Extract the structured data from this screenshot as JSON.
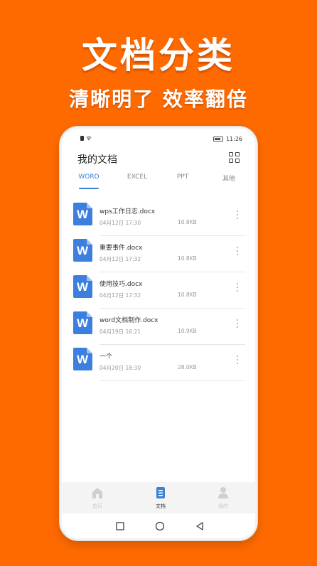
{
  "promo": {
    "headline": "文档分类",
    "subline": "清晰明了 效率翻倍"
  },
  "status_bar": {
    "time": "11:26"
  },
  "header": {
    "title": "我的文档"
  },
  "tabs": [
    {
      "label": "WORD",
      "active": true
    },
    {
      "label": "EXCEL",
      "active": false
    },
    {
      "label": "PPT",
      "active": false
    },
    {
      "label": "其他",
      "active": false
    }
  ],
  "files": [
    {
      "name": "wps工作日志.docx",
      "date": "04月12日 17:30",
      "size": "10.8KB"
    },
    {
      "name": "重要事件.docx",
      "date": "04月12日 17:32",
      "size": "10.8KB"
    },
    {
      "name": "使用技巧.docx",
      "date": "04月12日 17:32",
      "size": "10.8KB"
    },
    {
      "name": "word文档制作.docx",
      "date": "04月19日 16:21",
      "size": "10.9KB"
    },
    {
      "name": "一个",
      "date": "04月20日 18:30",
      "size": "28.0KB"
    }
  ],
  "bottom_nav": [
    {
      "label": "首页",
      "icon": "home-icon",
      "active": false
    },
    {
      "label": "文档",
      "icon": "document-icon",
      "active": true
    },
    {
      "label": "我的",
      "icon": "user-icon",
      "active": false
    }
  ],
  "colors": {
    "background": "#ff6a00",
    "accent": "#3b82d6",
    "doc_icon": "#3d7fde"
  }
}
